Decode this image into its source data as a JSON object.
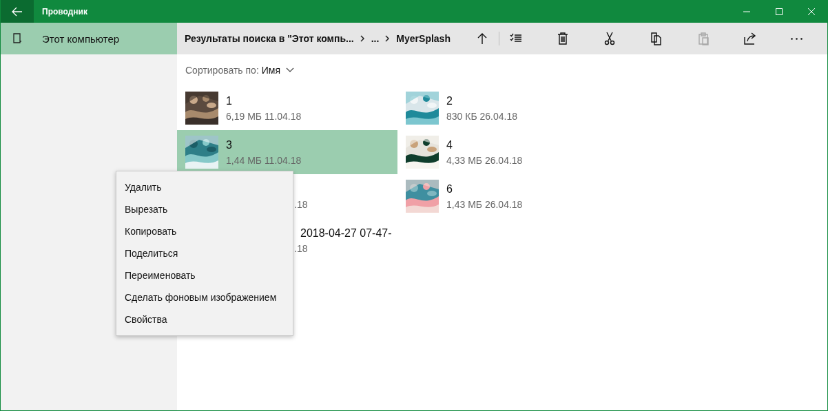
{
  "window": {
    "title": "Проводник"
  },
  "sidebar": {
    "items": [
      {
        "label": "Этот компьютер",
        "selected": true
      }
    ]
  },
  "breadcrumb": [
    {
      "label": "Результаты поиска в \"Этот компь..."
    },
    {
      "label": "..."
    },
    {
      "label": "MyerSplash"
    }
  ],
  "toolbar": [
    {
      "kind": "up",
      "disabled": false
    },
    {
      "kind": "divider"
    },
    {
      "kind": "select",
      "disabled": false
    },
    {
      "kind": "delete",
      "disabled": false
    },
    {
      "kind": "cut",
      "disabled": false
    },
    {
      "kind": "copy",
      "disabled": false
    },
    {
      "kind": "paste",
      "disabled": true
    },
    {
      "kind": "share",
      "disabled": false
    },
    {
      "kind": "more",
      "disabled": false
    }
  ],
  "sort": {
    "label": "Сортировать по:",
    "value": "Имя"
  },
  "files": [
    {
      "name": "1",
      "meta": "6,19 МБ 11.04.18",
      "selected": false,
      "covered": false
    },
    {
      "name": "2",
      "meta": "830 КБ 26.04.18",
      "selected": false,
      "covered": false
    },
    {
      "name": "3",
      "meta": "1,44 МБ 11.04.18",
      "selected": true,
      "covered": false
    },
    {
      "name": "4",
      "meta": "4,33 МБ 26.04.18",
      "selected": false,
      "covered": false
    },
    {
      "meta": ".18",
      "selected": false,
      "covered": true
    },
    {
      "name": "6",
      "meta": "1,43 МБ 26.04.18",
      "selected": false,
      "covered": false
    },
    {
      "name": "2018-04-27 07-47-",
      "meta": ".18",
      "selected": false,
      "covered": true
    }
  ],
  "context_menu": {
    "items": [
      "Удалить",
      "Вырезать",
      "Копировать",
      "Поделиться",
      "Переименовать",
      "Сделать фоновым изображением",
      "Свойства"
    ]
  }
}
